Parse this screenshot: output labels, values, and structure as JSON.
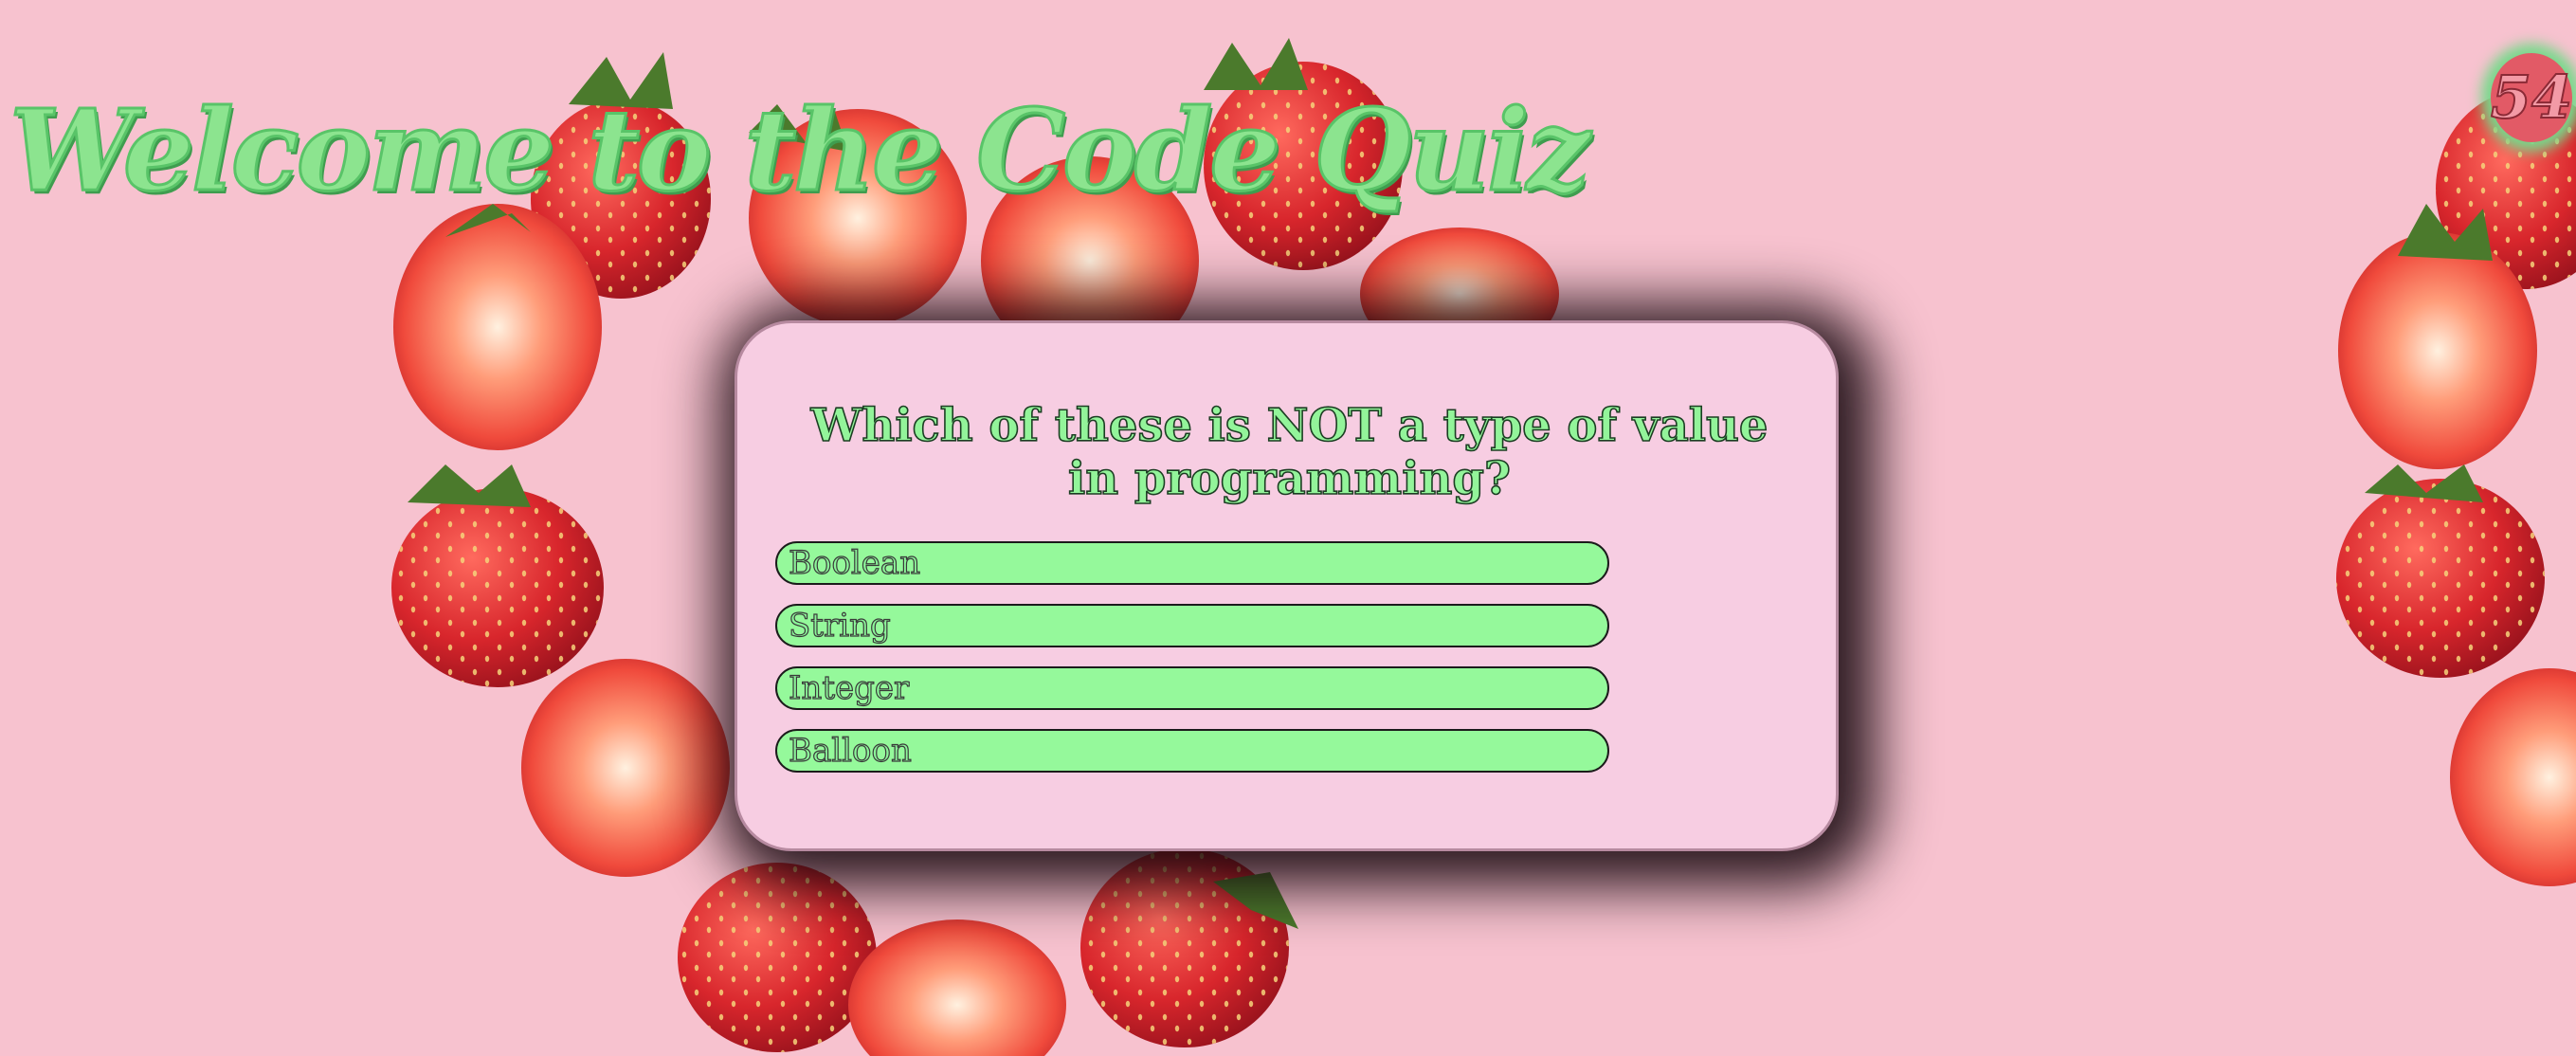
{
  "header": {
    "title": "Welcome to the Code Quiz"
  },
  "timer": {
    "value": "54"
  },
  "quiz": {
    "question": "Which of these is NOT a type of value in programming?",
    "answers": [
      "Boolean",
      "String",
      "Integer",
      "Balloon"
    ]
  },
  "background": {
    "decoration": "strawberry-heart",
    "color": "#f7c2cf"
  },
  "colors": {
    "accent_green": "#95f99b",
    "card": "#f7cde2",
    "timer": "#e25a66"
  }
}
